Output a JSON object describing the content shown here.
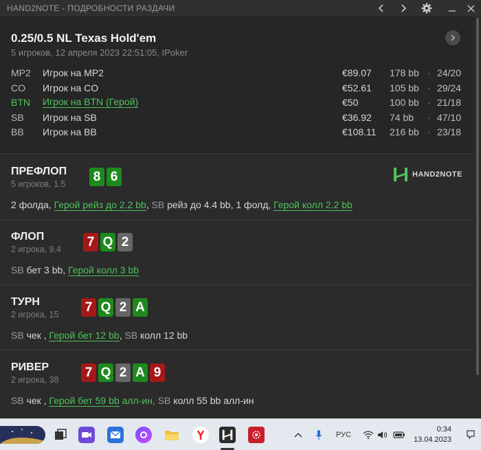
{
  "window": {
    "title": "HAND2NOTE - ПОДРОБНОСТИ РАЗДАЧИ"
  },
  "hand": {
    "title": "0.25/0.5 NL Texas Hold'em",
    "subtitle": "5 игроков, 12 апреля 2023 22:51:05, IPoker"
  },
  "players": [
    {
      "pos": "MP2",
      "name": "Игрок на MP2",
      "stack": "€89.07",
      "bb": "178 bb",
      "ratio": "24/20",
      "hero": false
    },
    {
      "pos": "CO",
      "name": "Игрок на CO",
      "stack": "€52.61",
      "bb": "105 bb",
      "ratio": "29/24",
      "hero": false
    },
    {
      "pos": "BTN",
      "name": "Игрок на BTN (Герой)",
      "stack": "€50",
      "bb": "100 bb",
      "ratio": "21/18",
      "hero": true
    },
    {
      "pos": "SB",
      "name": "Игрок на SB",
      "stack": "€36.92",
      "bb": "74 bb",
      "ratio": "47/10",
      "hero": false
    },
    {
      "pos": "BB",
      "name": "Игрок на BB",
      "stack": "€108.11",
      "bb": "216 bb",
      "ratio": "23/18",
      "hero": false
    }
  ],
  "separator": "·",
  "logo": {
    "text": "HAND2NOTE"
  },
  "streets": {
    "preflop": {
      "name": "ПРЕФЛОП",
      "sub": "5 игроков, 1.5",
      "cards": [
        "8",
        "6"
      ],
      "a1": "2 фолда, ",
      "a2": "Герой рейз до 2.2 bb",
      "a3": ", ",
      "a4": "SB",
      "a5": " рейз до 4.4 bb, 1 фолд, ",
      "a6": "Герой колл 2.2 bb"
    },
    "flop": {
      "name": "ФЛОП",
      "sub": "2 игрока, 9.4",
      "cards": [
        "7",
        "Q",
        "2"
      ],
      "a1": "SB",
      "a2": " бет 3 bb, ",
      "a3": "Герой колл 3 bb"
    },
    "turn": {
      "name": "ТУРН",
      "sub": "2 игрока, 15",
      "cards": [
        "7",
        "Q",
        "2",
        "A"
      ],
      "a1": "SB",
      "a2": " чек , ",
      "a3": "Герой бет 12 bb",
      "a4": ", ",
      "a5": "SB",
      "a6": " колл 12 bb"
    },
    "river": {
      "name": "РИВЕР",
      "sub": "2 игрока, 38",
      "cards": [
        "7",
        "Q",
        "2",
        "A",
        "9"
      ],
      "a1": "SB",
      "a2": " чек , ",
      "a3": "Герой бет 59 bb",
      "a4": " алл-ин, ",
      "a5": "SB",
      "a6": " колл 55 bb алл-ин"
    }
  },
  "taskbar": {
    "lang": "РУС",
    "time": "0:34",
    "date": "13.04.2023"
  },
  "colors": {
    "hero": "#4fc35a",
    "card_red": "#a41818",
    "card_green": "#1e8a1e",
    "card_gray": "#666666"
  }
}
